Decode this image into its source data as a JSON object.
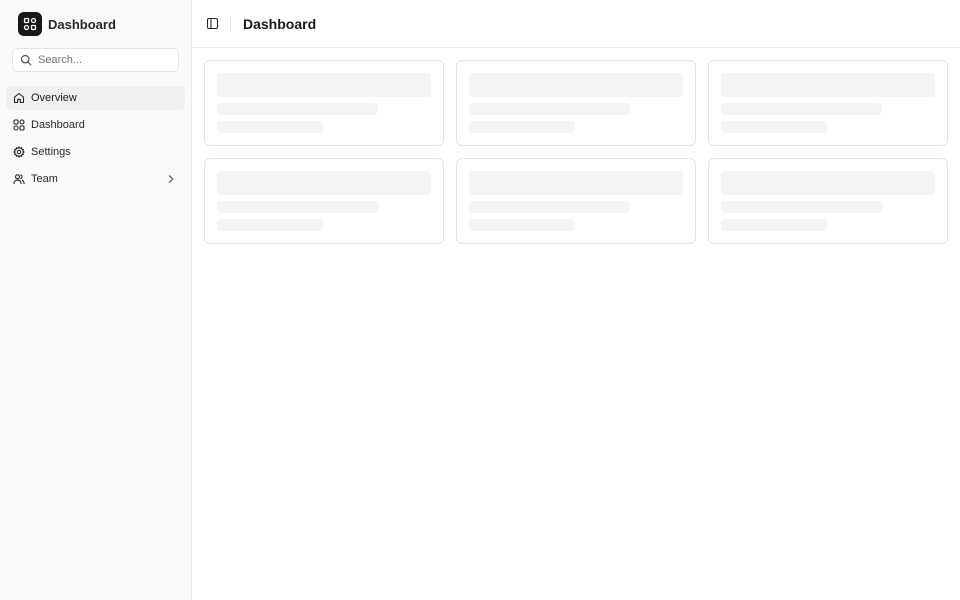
{
  "sidebar": {
    "brand": {
      "title": "Dashboard",
      "icon": "layout-grid-icon"
    },
    "search": {
      "placeholder": "Search...",
      "value": ""
    },
    "items": [
      {
        "label": "Overview",
        "icon": "home-icon",
        "active": true
      },
      {
        "label": "Dashboard",
        "icon": "layout-grid-icon",
        "active": false
      },
      {
        "label": "Settings",
        "icon": "gear-icon",
        "active": false
      },
      {
        "label": "Team",
        "icon": "users-icon",
        "active": false,
        "has_children": true
      }
    ]
  },
  "header": {
    "toggle_icon": "sidebar-toggle-icon",
    "title": "Dashboard"
  },
  "content": {
    "cards": [
      {
        "state": "loading"
      },
      {
        "state": "loading"
      },
      {
        "state": "loading"
      },
      {
        "state": "loading"
      },
      {
        "state": "loading"
      },
      {
        "state": "loading"
      }
    ]
  },
  "colors": {
    "sidebar_bg": "#fafafa",
    "active_item_bg": "#f0f0f1",
    "brand_logo_bg": "#18181b",
    "border": "#e4e4e7",
    "skeleton": "#f4f4f5",
    "text": "#18181b"
  }
}
